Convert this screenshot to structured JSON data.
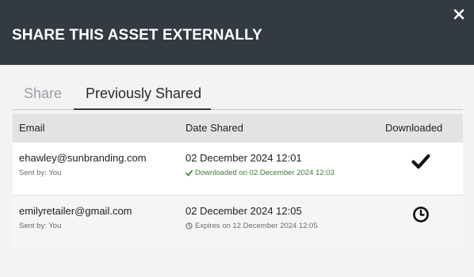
{
  "dialog": {
    "title": "SHARE THIS ASSET EXTERNALLY",
    "close_icon": "close-icon"
  },
  "tabs": [
    {
      "label": "Share",
      "active": false
    },
    {
      "label": "Previously Shared",
      "active": true
    }
  ],
  "table": {
    "headers": {
      "email": "Email",
      "date": "Date Shared",
      "downloaded": "Downloaded"
    },
    "rows": [
      {
        "email": "ehawley@sunbranding.com",
        "sent_by": "Sent by: You",
        "date_shared": "02 December 2024 12:01",
        "status_text": "Downloaded on 02 December 2024 12:03",
        "status_icon": "check-icon",
        "downloaded_icon": "checkmark-icon",
        "status_color": "#3f7a3a"
      },
      {
        "email": "emilyretailer@gmail.com",
        "sent_by": "Sent by: You",
        "date_shared": "02 December 2024 12:05",
        "status_text": "Expires on 12 December 2024 12:05",
        "status_icon": "clock-icon",
        "downloaded_icon": "clock-icon",
        "status_color": "#6e6e6e"
      }
    ]
  },
  "colors": {
    "header_bg": "#343a42",
    "body_bg": "#f3f3f3",
    "table_header_bg": "#e3e3e3"
  }
}
